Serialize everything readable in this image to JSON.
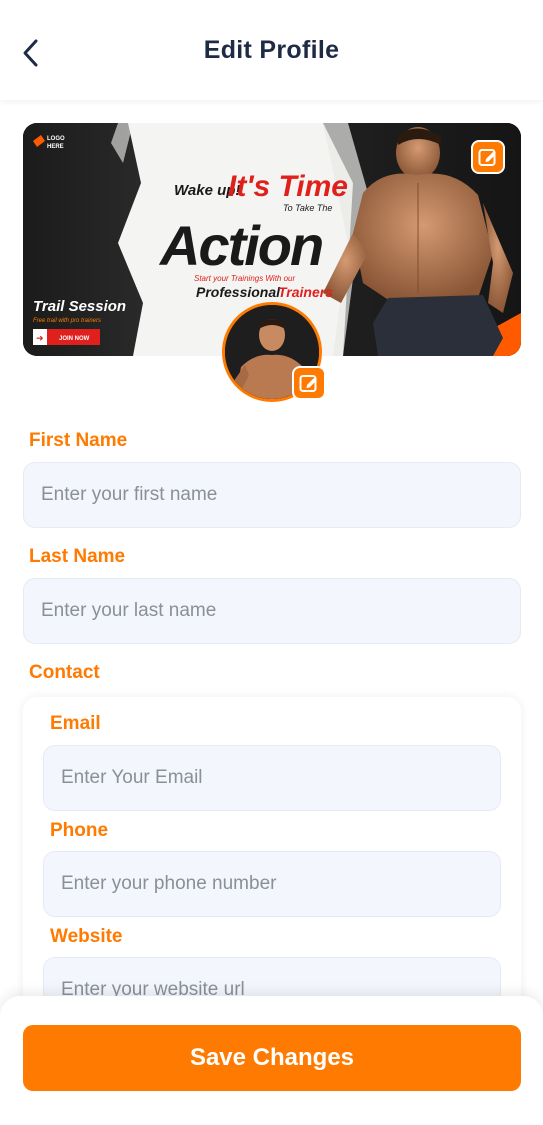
{
  "header": {
    "title": "Edit Profile",
    "back_icon": "chevron-left-icon"
  },
  "banner": {
    "logo_text_1": "LOGO",
    "logo_text_2": "HERE",
    "wake_up": "Wake up!",
    "its_time": "It's Time",
    "to_take_the": "To Take The",
    "action": "Action",
    "start_text": "Start your Trainings With our",
    "professional": "Professional",
    "trainers": "Trainers",
    "trail_session": "Trail Session",
    "free_trail": "Free trail with pro trainers",
    "join_now": "JOIN NOW"
  },
  "form": {
    "first_name_label": "First Name",
    "first_name_placeholder": "Enter your first name",
    "last_name_label": "Last Name",
    "last_name_placeholder": "Enter your last name",
    "contact_label": "Contact",
    "email_label": "Email",
    "email_placeholder": "Enter Your Email",
    "phone_label": "Phone",
    "phone_placeholder": "Enter your phone number",
    "website_label": "Website",
    "website_placeholder": "Enter your website url"
  },
  "footer": {
    "save_label": "Save Changes"
  },
  "colors": {
    "accent": "#ff7a00",
    "title": "#1f2a44",
    "input_bg": "#f3f6fc"
  }
}
